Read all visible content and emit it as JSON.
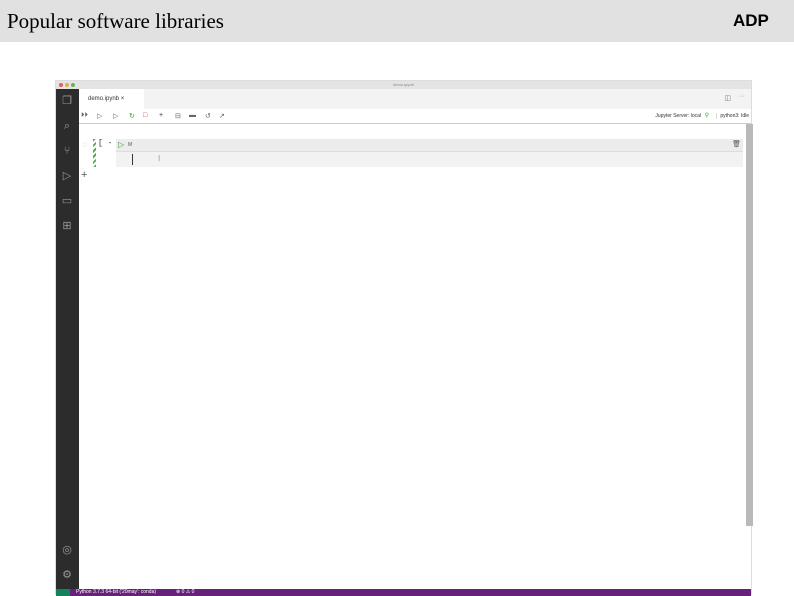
{
  "slide": {
    "title": "Popular software libraries",
    "logo": "ADP"
  },
  "window": {
    "title": "demo.ipynb",
    "tab": {
      "label": "demo.ipynb",
      "close": "×"
    },
    "toolbar": {
      "kernel_server": "Jupyter Server: local",
      "kernel": "python3: Idle"
    },
    "cell": {
      "prompt": "[ - ]",
      "lang": "M"
    },
    "status": {
      "python": "Python 3.7.3 64-bit ('20may': conda)",
      "problems": "⊗ 0 ⚠ 0"
    }
  },
  "colors": {
    "statusbar": "#68217a",
    "activity": "#2c2c2c",
    "run": "#3a9a3a"
  }
}
